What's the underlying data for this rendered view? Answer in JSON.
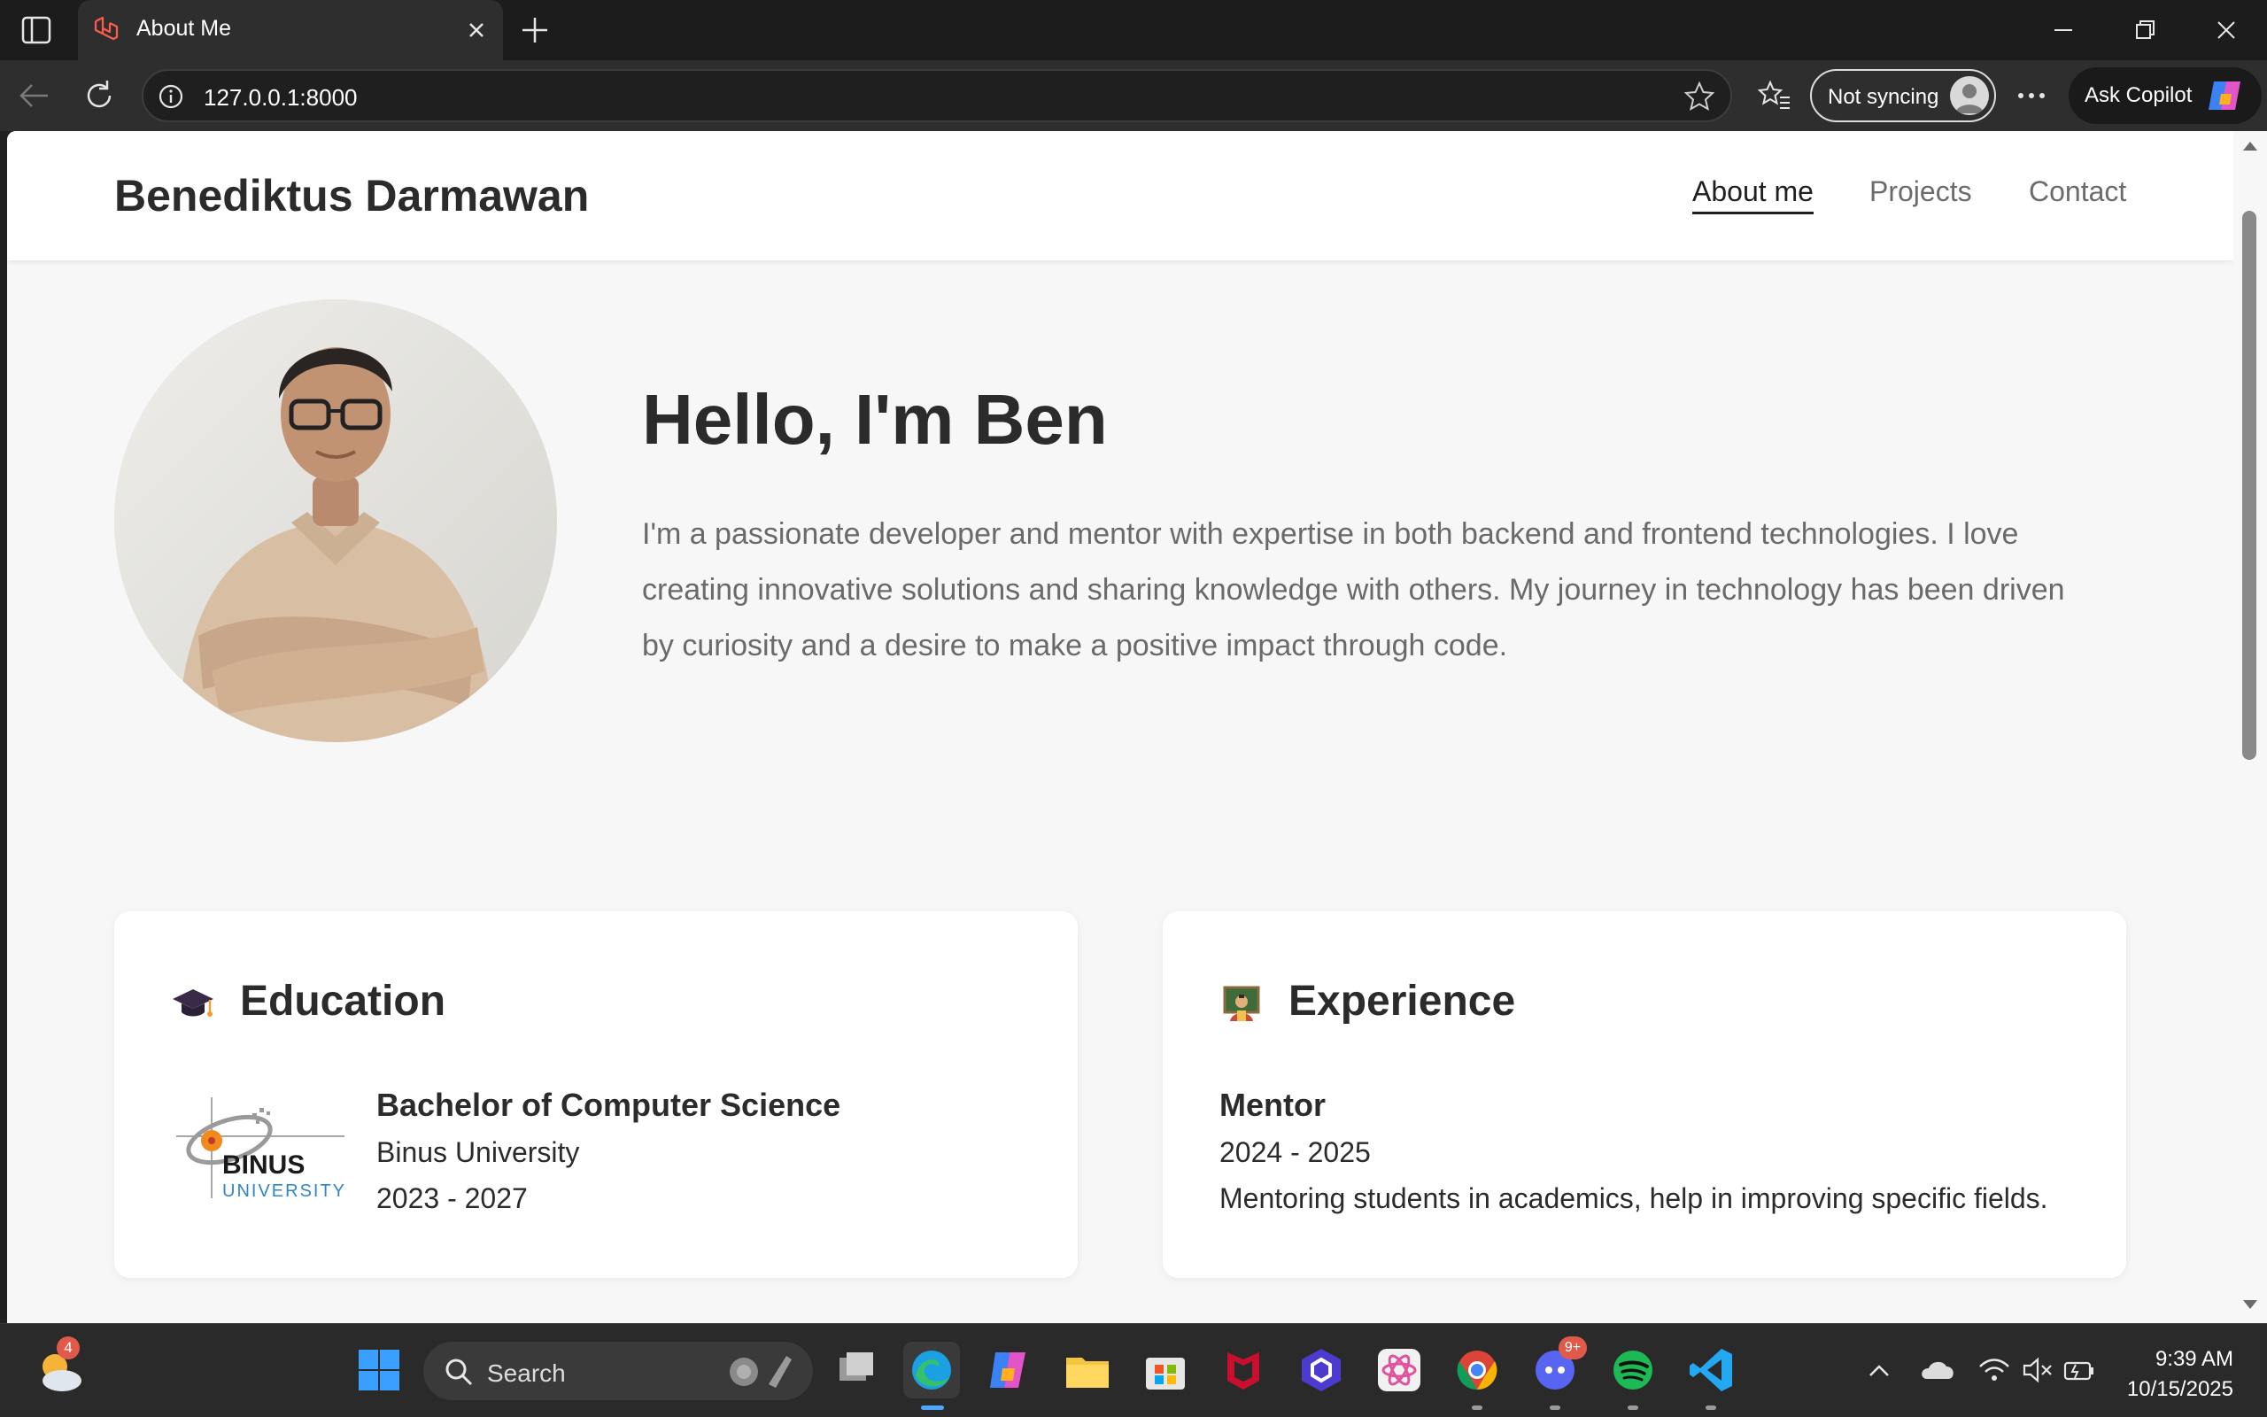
{
  "browser": {
    "tab_title": "About Me",
    "url": "127.0.0.1:8000",
    "sync_label": "Not syncing",
    "copilot_label": "Ask Copilot"
  },
  "site": {
    "brand": "Benediktus Darmawan",
    "nav": [
      {
        "label": "About me",
        "active": true
      },
      {
        "label": "Projects",
        "active": false
      },
      {
        "label": "Contact",
        "active": false
      }
    ]
  },
  "hero": {
    "title": "Hello, I'm Ben",
    "lines": [
      "I'm a passionate developer and mentor with expertise in both backend and frontend technologies. I love",
      "creating innovative solutions and sharing knowledge with others. My journey in technology has been driven",
      "by curiosity and a desire to make a positive impact through code."
    ]
  },
  "education": {
    "heading": "Education",
    "icon": "graduation-cap-icon",
    "degree": "Bachelor of Computer Science",
    "school": "Binus University",
    "years": "2023 - 2027",
    "logo_text": {
      "line1": "BINUS",
      "line2": "UNIVERSITY"
    }
  },
  "experience": {
    "heading": "Experience",
    "icon": "teacher-icon",
    "role": "Mentor",
    "years": "2024 - 2025",
    "description": "Mentoring students in academics, help in improving specific fields."
  },
  "taskbar": {
    "search_placeholder": "Search",
    "weather_badge": "4",
    "discord_badge": "9+",
    "time": "9:39 AM",
    "date": "10/15/2025"
  },
  "colors": {
    "page_bg": "#f7f7f7",
    "text_dark": "#2b2b2b",
    "text_muted": "#6a6a6a",
    "chrome_dark": "#1c1c1c"
  }
}
